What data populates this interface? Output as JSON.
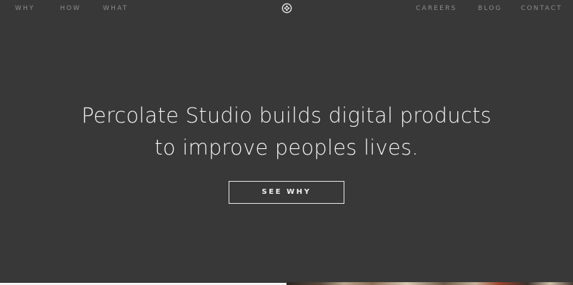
{
  "nav": {
    "left": [
      "WHY",
      "HOW",
      "WHAT"
    ],
    "right": [
      "CAREERS",
      "BLOG",
      "CONTACT"
    ]
  },
  "logo": {
    "icon": "percolate-logo-icon"
  },
  "hero": {
    "line1": "Percolate Studio builds digital products",
    "line2": "to improve peoples lives.",
    "cta_label": "SEE WHY"
  },
  "colors": {
    "background": "#383838",
    "text": "#f2f2f2",
    "nav_text": "#8c8c8c"
  }
}
